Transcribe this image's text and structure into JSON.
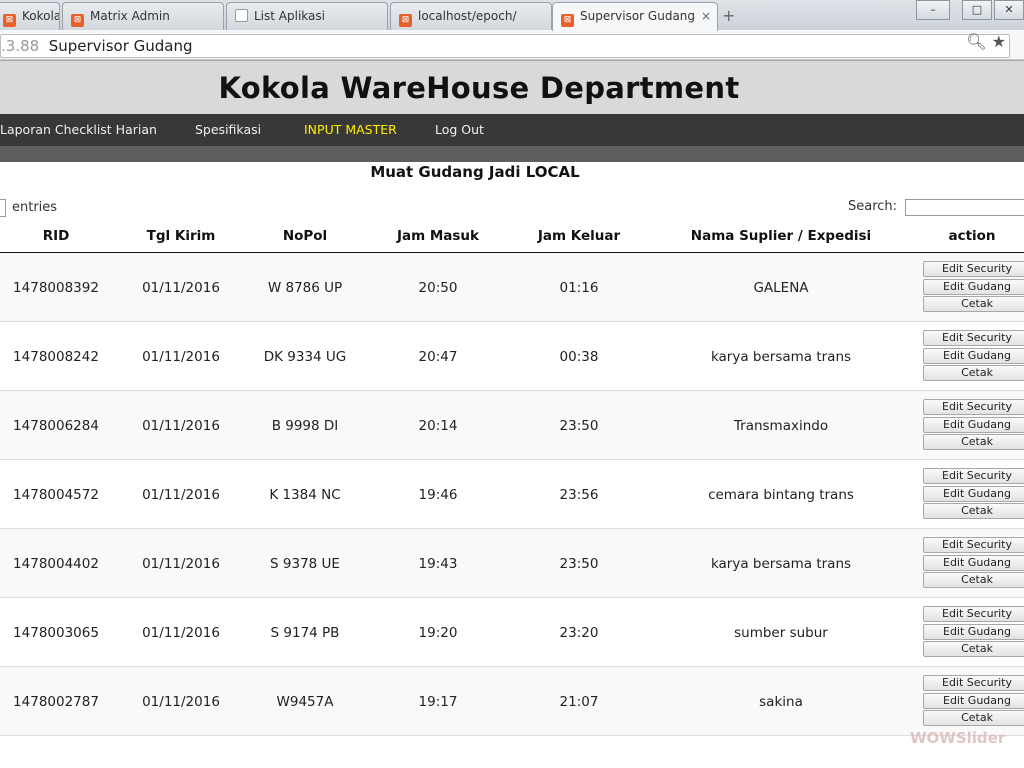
{
  "browser": {
    "tabs": [
      {
        "label": "Kokola",
        "icon": "xampp-icon"
      },
      {
        "label": "Matrix Admin",
        "icon": "xampp-icon"
      },
      {
        "label": "List Aplikasi",
        "icon": "page-icon"
      },
      {
        "label": "localhost/epoch/",
        "icon": "xampp-icon"
      },
      {
        "label": "Supervisor Gudang",
        "icon": "xampp-icon",
        "close": "×"
      }
    ],
    "new_tab": "+",
    "url_prefix": ".3.88",
    "url_text": "Supervisor Gudang",
    "window_controls": [
      "–",
      "□",
      "✕"
    ]
  },
  "page": {
    "title": "Kokola WareHouse Department",
    "nav": [
      "Laporan Checklist Harian",
      "Spesifikasi",
      "INPUT MASTER",
      "Log Out"
    ],
    "nav_active": "INPUT MASTER",
    "section_title": "Muat Gudang Jadi LOCAL",
    "entries_label": "entries",
    "search_label": "Search:",
    "search_value": ""
  },
  "table": {
    "headers": [
      "RID",
      "Tgl Kirim",
      "NoPol",
      "Jam Masuk",
      "Jam Keluar",
      "Nama Suplier / Expedisi",
      "action"
    ],
    "action_buttons": [
      "Edit Security",
      "Edit Gudang",
      "Cetak"
    ],
    "rows": [
      [
        "1478008392",
        "01/11/2016",
        "W 8786 UP",
        "20:50",
        "01:16",
        "GALENA"
      ],
      [
        "1478008242",
        "01/11/2016",
        "DK 9334 UG",
        "20:47",
        "00:38",
        "karya bersama trans"
      ],
      [
        "1478006284",
        "01/11/2016",
        "B 9998 DI",
        "20:14",
        "23:50",
        "Transmaxindo"
      ],
      [
        "1478004572",
        "01/11/2016",
        "K 1384 NC",
        "19:46",
        "23:56",
        "cemara bintang trans"
      ],
      [
        "1478004402",
        "01/11/2016",
        "S 9378 UE",
        "19:43",
        "23:50",
        "karya bersama trans"
      ],
      [
        "1478003065",
        "01/11/2016",
        "S 9174 PB",
        "19:20",
        "23:20",
        "sumber subur"
      ],
      [
        "1478002787",
        "01/11/2016",
        "W9457A",
        "19:17",
        "21:07",
        "sakina"
      ]
    ]
  },
  "watermark": "WOWSlider",
  "colors": {
    "nav_bg": "#383838",
    "nav_active": "#ffef00",
    "header_bg": "#d9d9d9"
  }
}
